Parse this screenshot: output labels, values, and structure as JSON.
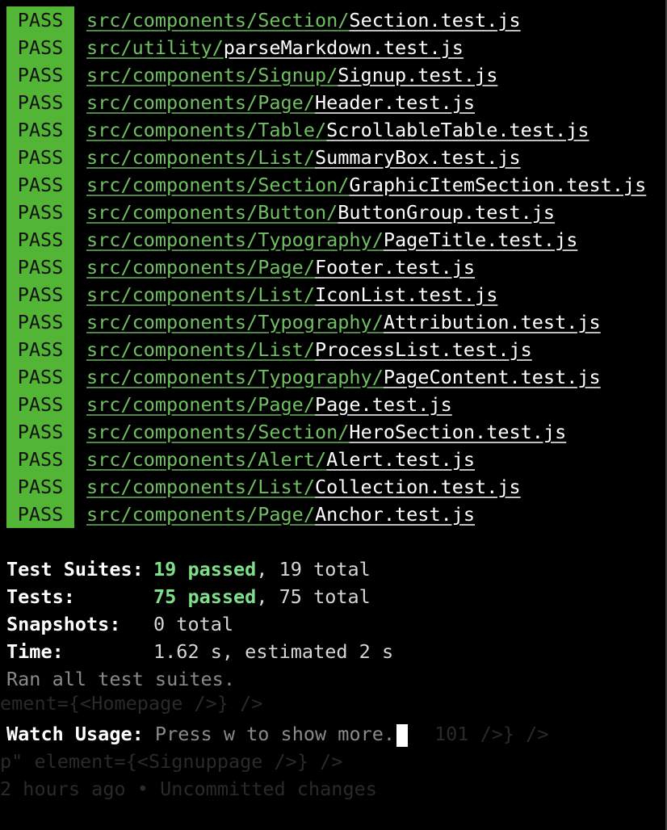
{
  "terminal": {
    "badge_label": "PASS",
    "results": [
      {
        "dir": "src/components/Section/",
        "file": "Section.test.js"
      },
      {
        "dir": "src/utility/",
        "file": "parseMarkdown.test.js"
      },
      {
        "dir": "src/components/Signup/",
        "file": "Signup.test.js"
      },
      {
        "dir": "src/components/Page/",
        "file": "Header.test.js"
      },
      {
        "dir": "src/components/Table/",
        "file": "ScrollableTable.test.js"
      },
      {
        "dir": "src/components/List/",
        "file": "SummaryBox.test.js"
      },
      {
        "dir": "src/components/Section/",
        "file": "GraphicItemSection.test.js"
      },
      {
        "dir": "src/components/Button/",
        "file": "ButtonGroup.test.js"
      },
      {
        "dir": "src/components/Typography/",
        "file": "PageTitle.test.js"
      },
      {
        "dir": "src/components/Page/",
        "file": "Footer.test.js"
      },
      {
        "dir": "src/components/List/",
        "file": "IconList.test.js"
      },
      {
        "dir": "src/components/Typography/",
        "file": "Attribution.test.js"
      },
      {
        "dir": "src/components/List/",
        "file": "ProcessList.test.js"
      },
      {
        "dir": "src/components/Typography/",
        "file": "PageContent.test.js"
      },
      {
        "dir": "src/components/Page/",
        "file": "Page.test.js"
      },
      {
        "dir": "src/components/Section/",
        "file": "HeroSection.test.js"
      },
      {
        "dir": "src/components/Alert/",
        "file": "Alert.test.js"
      },
      {
        "dir": "src/components/List/",
        "file": "Collection.test.js"
      },
      {
        "dir": "src/components/Page/",
        "file": "Anchor.test.js"
      }
    ],
    "summary": {
      "suites_label": "Test Suites:",
      "suites_passed": "19 passed",
      "suites_total": ", 19 total",
      "tests_label": "Tests:",
      "tests_passed": "75 passed",
      "tests_total": ", 75 total",
      "snapshots_label": "Snapshots:",
      "snapshots_value": "0 total",
      "time_label": "Time:",
      "time_value": "1.62 s, estimated 2 s",
      "ran_all": "Ran all test suites."
    },
    "watch": {
      "label": "Watch Usage:",
      "text": " Press w to show more."
    },
    "background_ghost": {
      "line1": "ement={<Homepage />} />",
      "line2": "p\" element={<Signuppage />} />",
      "line3": "2 hours ago • Uncommitted changes",
      "line4": "101 />} />"
    },
    "colors": {
      "background": "#000000",
      "pass_badge": "#52b535",
      "dir_text": "#6fc060",
      "passed_text": "#7ee08a"
    }
  }
}
